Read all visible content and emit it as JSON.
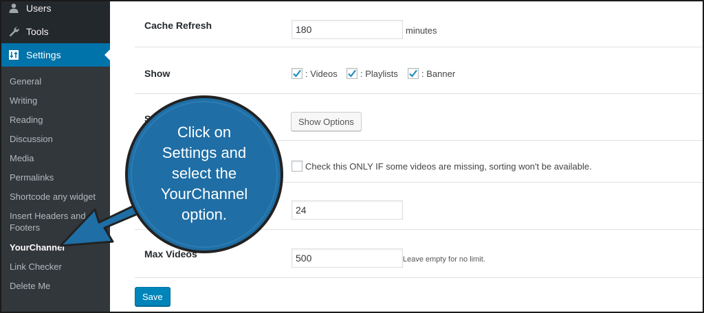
{
  "sidebar": {
    "menu": [
      {
        "label": "Users",
        "icon": "users-icon"
      },
      {
        "label": "Tools",
        "icon": "wrench-icon"
      },
      {
        "label": "Settings",
        "icon": "settings-icon",
        "active": true
      }
    ],
    "submenu": [
      {
        "label": "General"
      },
      {
        "label": "Writing"
      },
      {
        "label": "Reading"
      },
      {
        "label": "Discussion"
      },
      {
        "label": "Media"
      },
      {
        "label": "Permalinks"
      },
      {
        "label": "Shortcode any widget"
      },
      {
        "label": "Insert Headers and Footers"
      },
      {
        "label": "YourChannel",
        "current": true
      },
      {
        "label": "Link Checker"
      },
      {
        "label": "Delete Me"
      }
    ]
  },
  "form": {
    "cache_refresh": {
      "label": "Cache Refresh",
      "value": "180",
      "suffix": "minutes"
    },
    "show": {
      "label": "Show",
      "options": [
        {
          "label": ": Videos",
          "checked": true
        },
        {
          "label": ": Playlists",
          "checked": true
        },
        {
          "label": ": Banner",
          "checked": true
        }
      ]
    },
    "style": {
      "label_visible": "Styl",
      "button": "Show Options"
    },
    "missing": {
      "checked": false,
      "text": "Check this ONLY IF some videos are missing, sorting won't be available."
    },
    "per_page": {
      "value": "24"
    },
    "max_videos": {
      "label": "Max Videos",
      "value": "500",
      "hint": "Leave empty for no limit."
    },
    "save_label": "Save"
  },
  "callout": {
    "lines": [
      "Click on",
      "Settings and",
      "select the",
      "YourChannel",
      "option."
    ]
  },
  "colors": {
    "sidebar_bg": "#23282d",
    "submenu_bg": "#32373c",
    "active_bg": "#0073aa",
    "primary_button": "#0085ba",
    "callout_fill": "#1f6ea5",
    "callout_border": "#222222"
  }
}
